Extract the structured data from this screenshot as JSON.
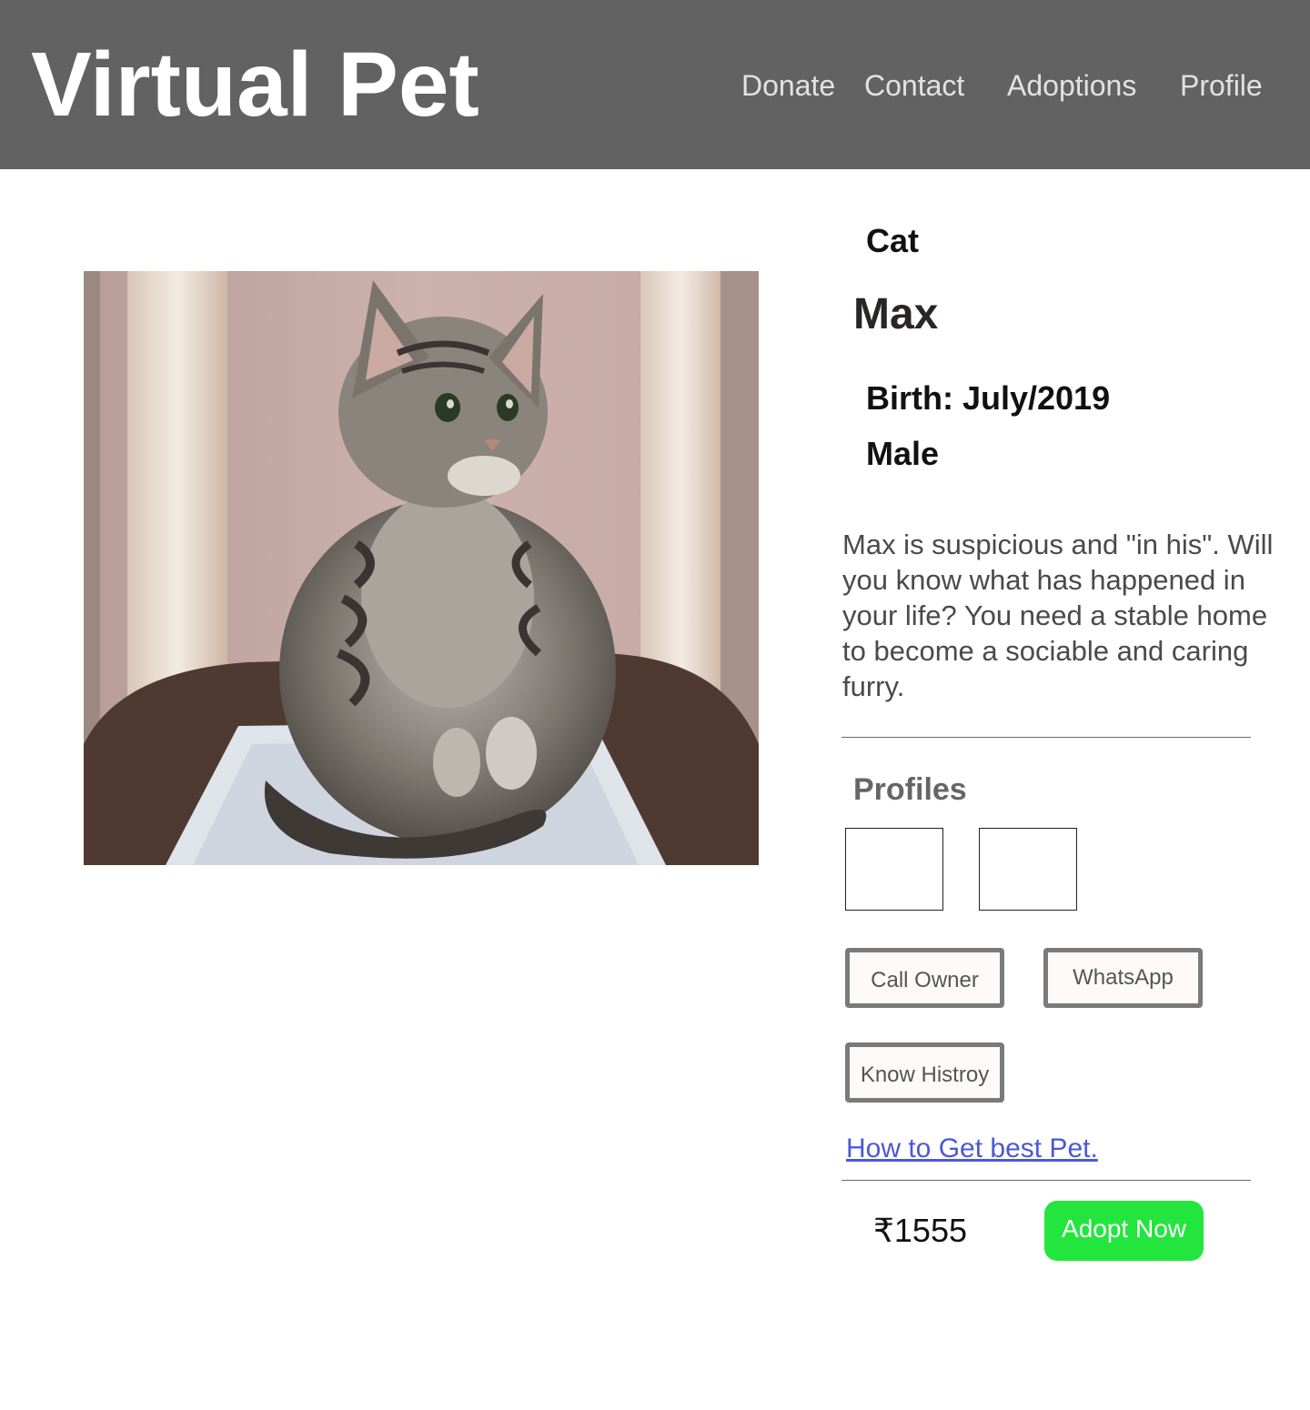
{
  "header": {
    "brand": "Virtual Pet",
    "nav": [
      "Donate",
      "Contact",
      "Adoptions",
      "Profile"
    ]
  },
  "photo": {
    "subject": "tabby-kitten-on-pet-bed"
  },
  "pet": {
    "species": "Cat",
    "name": "Max",
    "birth": "Birth: July/2019",
    "gender": "Male",
    "description": "Max is suspicious and \"in his\". Will you know what has happened in your life? You need a stable home to become a sociable and caring furry."
  },
  "profiles": {
    "title": "Profiles"
  },
  "actions": {
    "call": "Call Owner",
    "whatsapp": "WhatsApp",
    "history": "Know Histroy",
    "guide_link": "How to Get best Pet."
  },
  "purchase": {
    "price": "₹1555",
    "adopt": "Adopt Now"
  },
  "colors": {
    "header_bg": "#626262",
    "adopt_button": "#22e63e",
    "link": "#4a58d8"
  }
}
